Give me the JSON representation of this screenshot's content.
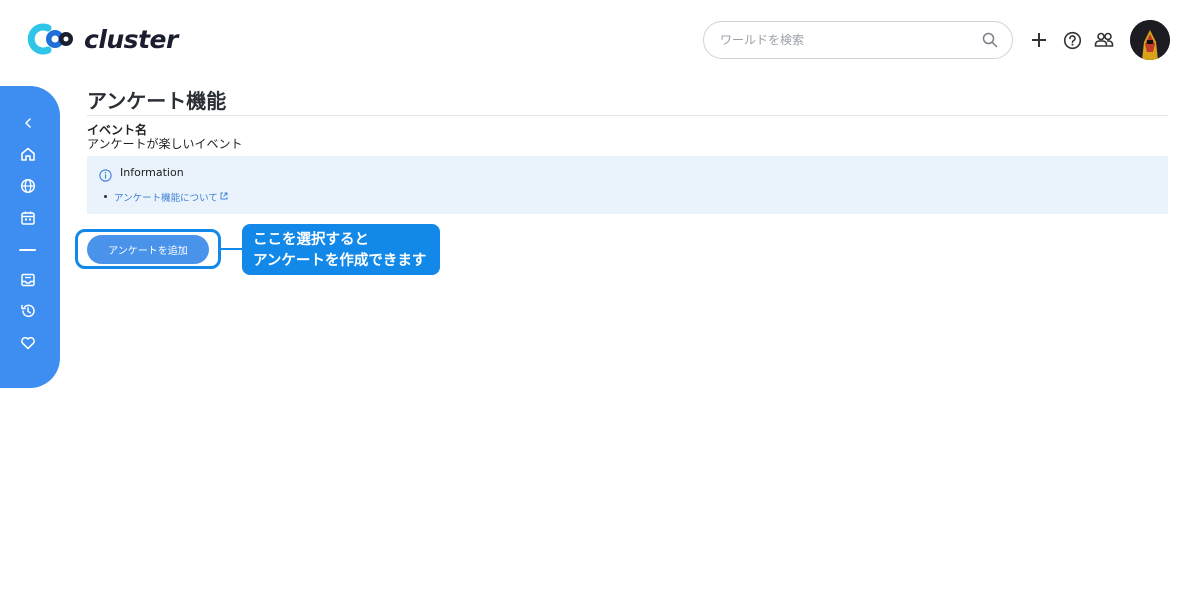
{
  "header": {
    "logo_text": "cluster",
    "search": {
      "placeholder": "ワールドを検索",
      "value": ""
    },
    "icons": [
      "plus-icon",
      "help-icon",
      "friends-icon"
    ],
    "avatar": "user-avatar"
  },
  "sidebar": {
    "items": [
      {
        "icon": "chevron-left-icon"
      },
      {
        "icon": "home-icon"
      },
      {
        "icon": "globe-icon"
      },
      {
        "icon": "calendar-icon"
      },
      {
        "icon": "separator"
      },
      {
        "icon": "inbox-icon"
      },
      {
        "icon": "history-icon"
      },
      {
        "icon": "heart-icon"
      }
    ]
  },
  "main": {
    "title": "アンケート機能",
    "event_label": "イベント名",
    "event_name": "アンケートが楽しいイベント",
    "info": {
      "title": "Information",
      "link_label": "アンケート機能について"
    },
    "add_button_label": "アンケートを追加",
    "callout": {
      "line1": "ここを選択すると",
      "line2": "アンケートを作成できます"
    }
  },
  "colors": {
    "accent": "#3d8ef0",
    "callout": "#1289e8",
    "info_bg": "#eaf3fb",
    "link": "#3b7fd6"
  }
}
